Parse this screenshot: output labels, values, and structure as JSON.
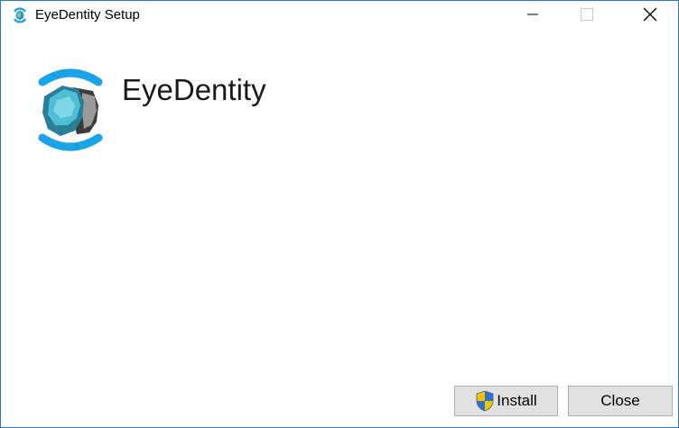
{
  "window": {
    "title": "EyeDentity Setup",
    "border_color": "#2b79c2"
  },
  "header": {
    "app_name": "EyeDentity",
    "logo_icon": "eyedentity-logo-icon"
  },
  "buttons": {
    "install_label": "Install",
    "install_icon": "uac-shield-icon",
    "close_label": "Close"
  },
  "colors": {
    "accent": "#1aa3e8",
    "face": "#3fb4c9",
    "button_bg": "#e1e1e1"
  }
}
